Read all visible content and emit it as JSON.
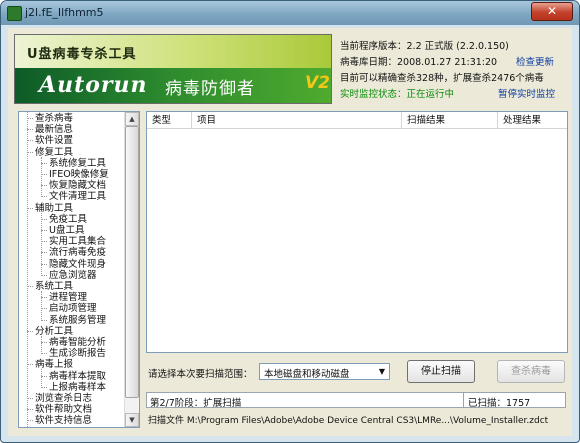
{
  "window": {
    "title": "j2l.fE_Ilfhmm5",
    "close_glyph": "✕"
  },
  "banner": {
    "product_title": "U盘病毒专杀工具",
    "logo_text": "Autorun",
    "logo_name": "病毒防御者",
    "logo_version": "V2"
  },
  "info": {
    "version": "当前程序版本：2.2 正式版 (2.2.0.150)",
    "db_date": "病毒库日期：2008.01.27 21:31:20",
    "check_update": "检查更新",
    "capability": "目前可以精确查杀328种，扩展查杀2476个病毒",
    "monitor_status": "实时监控状态：正在运行中",
    "pause_monitor": "暂停实时监控"
  },
  "tree": {
    "items": [
      {
        "label": "查杀病毒",
        "level": 0
      },
      {
        "label": "最新信息",
        "level": 0
      },
      {
        "label": "软件设置",
        "level": 0
      },
      {
        "label": "修复工具",
        "level": 0
      },
      {
        "label": "系统修复工具",
        "level": 1
      },
      {
        "label": "IFEO映像修复",
        "level": 1
      },
      {
        "label": "恢复隐藏文档",
        "level": 1
      },
      {
        "label": "文件清理工具",
        "level": 1
      },
      {
        "label": "辅助工具",
        "level": 0
      },
      {
        "label": "免疫工具",
        "level": 1
      },
      {
        "label": "U盘工具",
        "level": 1
      },
      {
        "label": "实用工具集合",
        "level": 1
      },
      {
        "label": "流行病毒免疫",
        "level": 1
      },
      {
        "label": "隐藏文件现身",
        "level": 1
      },
      {
        "label": "应急浏览器",
        "level": 1
      },
      {
        "label": "系统工具",
        "level": 0
      },
      {
        "label": "进程管理",
        "level": 1
      },
      {
        "label": "启动项管理",
        "level": 1
      },
      {
        "label": "系统服务管理",
        "level": 1
      },
      {
        "label": "分析工具",
        "level": 0
      },
      {
        "label": "病毒智能分析",
        "level": 1
      },
      {
        "label": "生成诊断报告",
        "level": 1
      },
      {
        "label": "病毒上报",
        "level": 0
      },
      {
        "label": "病毒样本提取",
        "level": 1
      },
      {
        "label": "上报病毒样本",
        "level": 1
      },
      {
        "label": "浏览查杀日志",
        "level": 0
      },
      {
        "label": "软件帮助文档",
        "level": 0
      },
      {
        "label": "软件支持信息",
        "level": 0
      }
    ]
  },
  "results": {
    "columns": [
      "类型",
      "项目",
      "扫描结果",
      "处理结果"
    ]
  },
  "controls": {
    "scan_range_label": "请选择本次要扫描范围：",
    "scan_range_value": "本地磁盘和移动磁盘",
    "stop_button": "停止扫描",
    "kill_button": "查杀病毒"
  },
  "status": {
    "stage": "第2/7阶段：扩展扫描",
    "scanned": "已扫描：1757"
  },
  "scan_file": "扫描文件 M:\\Program Files\\Adobe\\Adobe Device Central CS3\\LMRe...\\Volume_Installer.zdct"
}
